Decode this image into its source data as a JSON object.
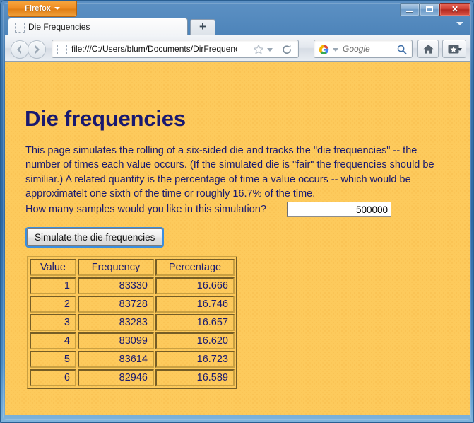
{
  "browser": {
    "app_menu_label": "Firefox",
    "window_controls": {
      "minimize": "Minimize",
      "maximize": "Maximize",
      "close": "✕"
    },
    "titlebar_dropdown": "titlebar-dropdown",
    "tab": {
      "title": "Die Frequencies",
      "new_tab_label": "+"
    },
    "navigation": {
      "back_label": "Back",
      "forward_label": "Forward",
      "url": "file:///C:/Users/blum/Documents/DirFrequencies.",
      "reload_label": "Reload",
      "star_label": "Bookmark this page",
      "home_label": "Home",
      "bookmarks_label": "Bookmarks"
    },
    "search": {
      "engine": "Google",
      "placeholder": "Google"
    }
  },
  "page": {
    "heading": "Die frequencies",
    "intro": "This page simulates the rolling of a six-sided die and tracks the \"die frequencies\" -- the number of times each value occurs. (If the simulated die is \"fair\" the frequencies should be similiar.) A related quantity is the percentage of time a value occurs -- which would be approximatelt one sixth of the time or roughly 16.7% of the time.",
    "form": {
      "sample_label": "How many samples would you like in this simulation?",
      "sample_value": "500000",
      "sample_placeholder": "",
      "simulate_button": "Simulate the die frequencies"
    },
    "table": {
      "columns": [
        "Value",
        "Frequency",
        "Percentage"
      ],
      "rows": [
        {
          "value": "1",
          "frequency": "83330",
          "percentage": "16.666"
        },
        {
          "value": "2",
          "frequency": "83728",
          "percentage": "16.746"
        },
        {
          "value": "3",
          "frequency": "83283",
          "percentage": "16.657"
        },
        {
          "value": "4",
          "frequency": "83099",
          "percentage": "16.620"
        },
        {
          "value": "5",
          "frequency": "83614",
          "percentage": "16.723"
        },
        {
          "value": "6",
          "frequency": "82946",
          "percentage": "16.589"
        }
      ]
    }
  },
  "colors": {
    "page_background": "#fdca5c",
    "text": "#191970",
    "firefox_orange": "#ef8c22",
    "close_red": "#cf4034",
    "focus_blue": "#3a8ee0"
  }
}
